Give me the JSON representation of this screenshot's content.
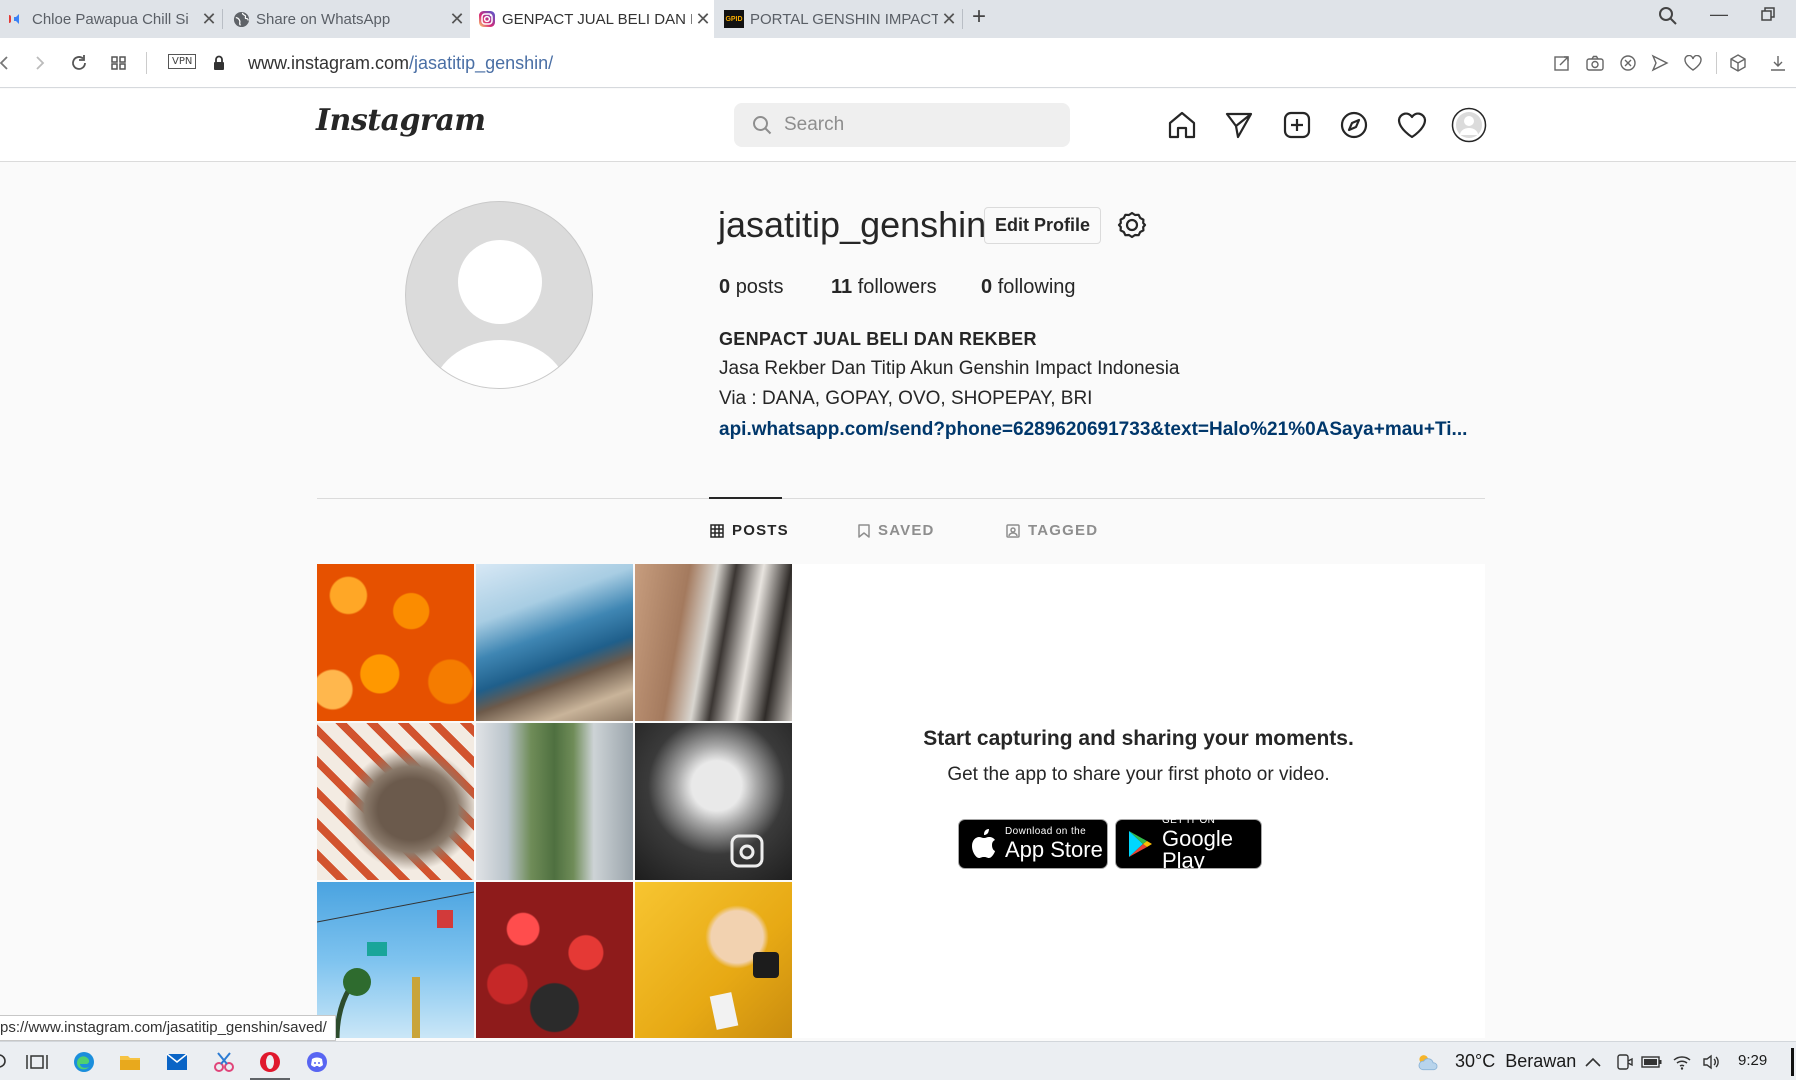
{
  "browser": {
    "tabs": [
      {
        "title": "Chloe Pawapua Chill Si",
        "favicon": "youtube-icon"
      },
      {
        "title": "Share on WhatsApp",
        "favicon": "globe-icon"
      },
      {
        "title": "GENPACT JUAL BELI DAN R",
        "favicon": "instagram-icon",
        "active": true
      },
      {
        "title": "PORTAL GENSHIN IMPACT",
        "favicon": "gpid-icon",
        "favicon_text": "GPID"
      }
    ],
    "vpn_label": "VPN",
    "url_domain": "www.instagram.com",
    "url_path": "/jasatitip_genshin/",
    "status_url": "ps://www.instagram.com/jasatitip_genshin/saved/"
  },
  "instagram": {
    "logo": "Instagram",
    "search_placeholder": "Search",
    "profile": {
      "username": "jasatitip_genshin",
      "edit_profile_label": "Edit Profile",
      "posts_count": "0",
      "posts_label": "posts",
      "followers_count": "11",
      "followers_label": "followers",
      "following_count": "0",
      "following_label": "following",
      "full_name": "GENPACT JUAL BELI DAN REKBER",
      "bio_lines": [
        "Jasa Rekber Dan Titip Akun Genshin Impact Indonesia",
        "Via : DANA, GOPAY, OVO, SHOPEPAY, BRI"
      ],
      "bio_link": "api.whatsapp.com/send?phone=6289620691733&text=Halo%21%0ASaya+mau+Ti..."
    },
    "tabs": [
      {
        "label": "POSTS",
        "icon": "grid-icon",
        "active": true
      },
      {
        "label": "SAVED",
        "icon": "bookmark-icon",
        "active": false
      },
      {
        "label": "TAGGED",
        "icon": "tag-person-icon",
        "active": false
      }
    ],
    "empty_state": {
      "title": "Start capturing and sharing your moments.",
      "subtitle": "Get the app to share your first photo or video.",
      "app_store": {
        "small": "Download on the",
        "big": "App Store"
      },
      "google_play": {
        "small": "GET IT ON",
        "big": "Google Play"
      }
    }
  },
  "taskbar": {
    "temperature": "30°C",
    "weather": "Berawan",
    "time": "9:29"
  }
}
